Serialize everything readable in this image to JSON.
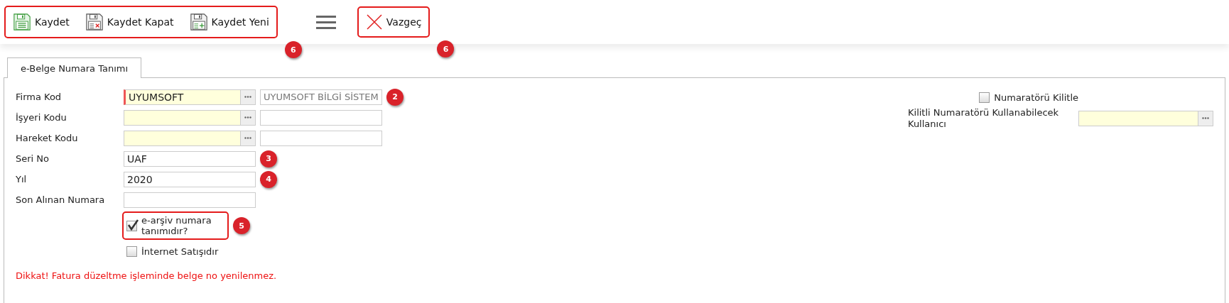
{
  "toolbar": {
    "groups": [
      {
        "highlighted": true,
        "callout": "6",
        "buttons": [
          {
            "label": "Kaydet",
            "kind": "save"
          },
          {
            "label": "Kaydet Kapat",
            "kind": "save-close"
          },
          {
            "label": "Kaydet Yeni",
            "kind": "save-new"
          }
        ]
      },
      {
        "highlighted": true,
        "callout": "6",
        "buttons": [
          {
            "label": "Vazgeç",
            "kind": "cancel"
          }
        ]
      }
    ]
  },
  "tabs": [
    {
      "label": "e-Belge Numara Tanımı",
      "selected": true
    }
  ],
  "fields": [
    {
      "label": "Firma Kod",
      "kind": "lookup",
      "value": "UYUMSOFT",
      "description": "UYUMSOFT BİLGİ SİSTEM",
      "required": true,
      "callout": "2"
    },
    {
      "label": "İşyeri Kodu",
      "kind": "lookup",
      "required": false
    },
    {
      "label": "Hareket Kodu",
      "kind": "lookup",
      "required": false
    },
    {
      "label": "Seri No",
      "kind": "text",
      "value": "UAF",
      "callout": "3"
    },
    {
      "label": "Yıl",
      "kind": "text",
      "value": "2020",
      "callout": "4"
    },
    {
      "label": "Son Alınan Numara",
      "kind": "text"
    }
  ],
  "checkboxes": [
    {
      "label": "e-arşiv numara tanımıdır?",
      "checked": true,
      "highlighted": true,
      "callout": "5"
    },
    {
      "label": "İnternet Satışıdır",
      "checked": false,
      "highlighted": false
    }
  ],
  "warning": "Dikkat! Fatura düzeltme işleminde belge no yenilenmez.",
  "right": {
    "lock": {
      "label": "Numaratörü Kilitle",
      "checked": false
    },
    "user_field": {
      "label": "Kilitli Numaratörü Kullanabilecek Kullanıcı"
    }
  }
}
